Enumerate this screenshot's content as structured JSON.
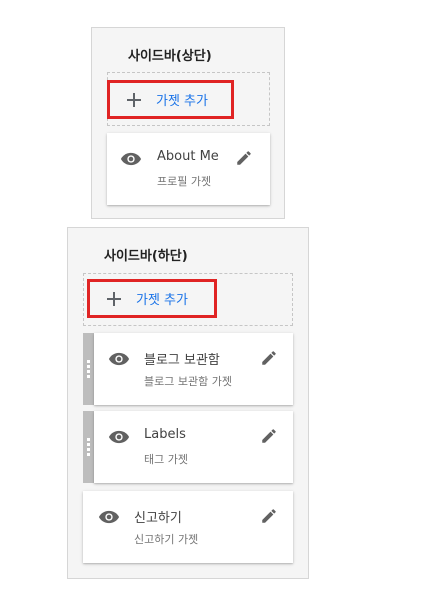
{
  "sections": {
    "top": {
      "title": "사이드바(상단)",
      "add_label": "가젯 추가",
      "widgets": [
        {
          "title": "About Me",
          "subtitle": "프로필 가젯"
        }
      ]
    },
    "bottom": {
      "title": "사이드바(하단)",
      "add_label": "가젯 추가",
      "widgets": [
        {
          "title": "블로그 보관함",
          "subtitle": "블로그 보관함 가젯"
        },
        {
          "title": "Labels",
          "subtitle": "태그 가젯"
        },
        {
          "title": "신고하기",
          "subtitle": "신고하기 가젯"
        }
      ]
    }
  },
  "icons": {
    "add": "plus-icon",
    "visibility": "eye-icon",
    "edit": "pencil-icon",
    "drag": "drag-handle-icon"
  },
  "colors": {
    "accent": "#1a73e8",
    "highlight": "#e02424",
    "panel_bg": "#f5f5f5",
    "icon": "#616161"
  }
}
